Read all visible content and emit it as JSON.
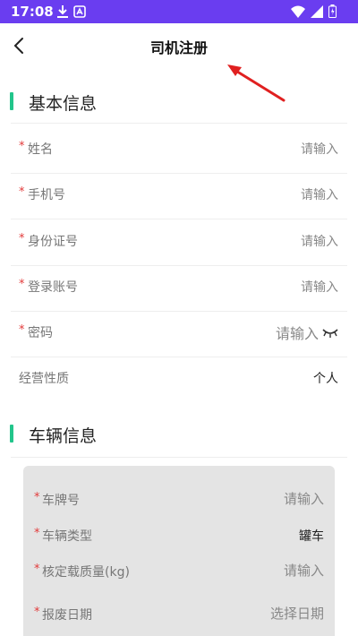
{
  "status_bar": {
    "time": "17:08",
    "color": "#6a3df0"
  },
  "header": {
    "title": "司机注册",
    "back_icon": "chevron-left-icon"
  },
  "sections": {
    "basic": {
      "title": "基本信息",
      "fields": [
        {
          "label": "姓名",
          "value": "请输入",
          "required": true
        },
        {
          "label": "手机号",
          "value": "请输入",
          "required": true
        },
        {
          "label": "身份证号",
          "value": "请输入",
          "required": true
        },
        {
          "label": "登录账号",
          "value": "请输入",
          "required": true
        },
        {
          "label": "密码",
          "value": "请输入",
          "required": true,
          "icon": "eye-closed-icon"
        },
        {
          "label": "经营性质",
          "value": "个人",
          "required": false
        }
      ]
    },
    "vehicle": {
      "title": "车辆信息",
      "fields": [
        {
          "label": "车牌号",
          "value": "请输入",
          "required": true
        },
        {
          "label": "车辆类型",
          "value": "罐车",
          "required": true
        },
        {
          "label": "核定载质量(kg)",
          "value": "请输入",
          "required": true
        },
        {
          "label": "报废日期",
          "value": "选择日期",
          "required": true
        }
      ]
    }
  },
  "required_mark": "*",
  "colors": {
    "accent": "#22c58b",
    "required": "#e23b3b",
    "annotation_arrow": "#e02020"
  }
}
